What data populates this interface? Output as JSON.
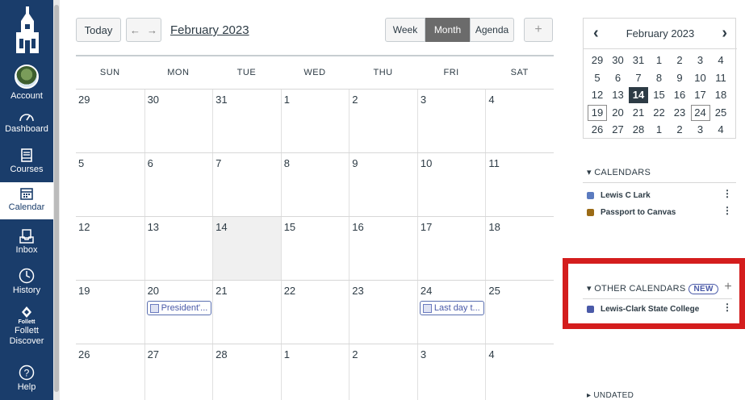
{
  "nav": {
    "items": [
      {
        "label": "Account",
        "icon": "avatar"
      },
      {
        "label": "Dashboard",
        "icon": "dashboard-icon"
      },
      {
        "label": "Courses",
        "icon": "courses-icon"
      },
      {
        "label": "Calendar",
        "icon": "calendar-icon"
      },
      {
        "label": "Inbox",
        "icon": "inbox-icon"
      },
      {
        "label": "History",
        "icon": "history-icon"
      },
      {
        "label": "Follett Discover",
        "icon": "follett-icon"
      },
      {
        "label": "Help",
        "icon": "help-icon"
      }
    ],
    "follett_logo_text": "Follett",
    "follett_label_1": "Follett",
    "follett_label_2": "Discover"
  },
  "toolbar": {
    "today": "Today",
    "prev": "←",
    "next": "→",
    "month": "February 2023",
    "views": [
      "Week",
      "Month",
      "Agenda"
    ],
    "selected_view": "Month",
    "add": "+"
  },
  "days_of_week": [
    "SUN",
    "MON",
    "TUE",
    "WED",
    "THU",
    "FRI",
    "SAT"
  ],
  "weeks": [
    [
      "29",
      "30",
      "31",
      "1",
      "2",
      "3",
      "4"
    ],
    [
      "5",
      "6",
      "7",
      "8",
      "9",
      "10",
      "11"
    ],
    [
      "12",
      "13",
      "14",
      "15",
      "16",
      "17",
      "18"
    ],
    [
      "19",
      "20",
      "21",
      "22",
      "23",
      "24",
      "25"
    ],
    [
      "26",
      "27",
      "28",
      "1",
      "2",
      "3",
      "4"
    ]
  ],
  "events": [
    {
      "title": "President'...",
      "week": 3,
      "day": 1
    },
    {
      "title": "Last day t...",
      "week": 3,
      "day": 5
    }
  ],
  "mini_calendar": {
    "title": "February 2023",
    "prev": "‹",
    "next": "›",
    "weeks": [
      [
        "29",
        "30",
        "31",
        "1",
        "2",
        "3",
        "4"
      ],
      [
        "5",
        "6",
        "7",
        "8",
        "9",
        "10",
        "11"
      ],
      [
        "12",
        "13",
        "14",
        "15",
        "16",
        "17",
        "18"
      ],
      [
        "19",
        "20",
        "21",
        "22",
        "23",
        "24",
        "25"
      ],
      [
        "26",
        "27",
        "28",
        "1",
        "2",
        "3",
        "4"
      ]
    ],
    "today": "14"
  },
  "calendars": {
    "title": "CALENDARS",
    "items": [
      {
        "name": "Lewis C Lark",
        "color": "#5b7bbf"
      },
      {
        "name": "Passport to Canvas",
        "color": "#9b6b16"
      }
    ]
  },
  "other_calendars": {
    "title": "OTHER CALENDARS",
    "badge": "NEW",
    "add": "+",
    "items": [
      {
        "name": "Lewis-Clark State College",
        "color": "#4a5aa8"
      }
    ]
  },
  "undated": {
    "title": "UNDATED"
  },
  "colors": {
    "nav_bg": "#1a3d6b",
    "highlight": "#d41d1d",
    "selected_view": "#6b6b6b"
  }
}
